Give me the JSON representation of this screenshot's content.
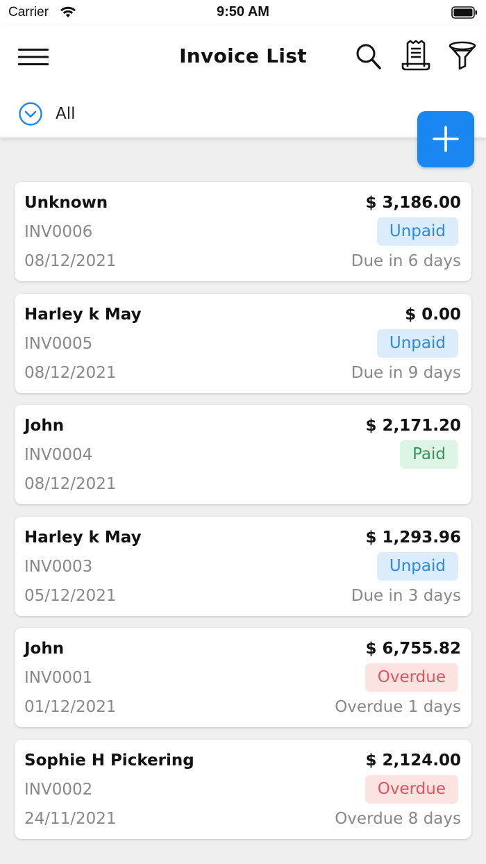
{
  "status_bar": {
    "carrier": "Carrier",
    "time": "9:50 AM",
    "icons": [
      "wifi-icon",
      "battery-icon"
    ]
  },
  "header": {
    "title": "Invoice List",
    "icons": [
      "menu-icon",
      "search-icon",
      "receipt-icon",
      "filter-icon"
    ],
    "filter": {
      "selected": "All",
      "icon": "chevron-circle-icon"
    }
  },
  "fab": {
    "icon": "plus-icon"
  },
  "colors": {
    "accent": "#1a87f0",
    "unpaid_bg": "#dbecfd",
    "unpaid_text": "#2b8ae6",
    "paid_bg": "#ddf5e4",
    "paid_text": "#3d8f5a",
    "overdue_bg": "#fde2e2",
    "overdue_text": "#e2545a",
    "background": "#efefef"
  },
  "invoices": [
    {
      "name": "Unknown",
      "amount": "$ 3,186.00",
      "number": "INV0006",
      "date": "08/12/2021",
      "status": "Unpaid",
      "due": "Due in 6 days"
    },
    {
      "name": "Harley k May",
      "amount": "$ 0.00",
      "number": "INV0005",
      "date": "08/12/2021",
      "status": "Unpaid",
      "due": "Due in 9 days"
    },
    {
      "name": "John",
      "amount": "$ 2,171.20",
      "number": "INV0004",
      "date": "08/12/2021",
      "status": "Paid",
      "due": ""
    },
    {
      "name": "Harley k May",
      "amount": "$ 1,293.96",
      "number": "INV0003",
      "date": "05/12/2021",
      "status": "Unpaid",
      "due": "Due in 3 days"
    },
    {
      "name": "John",
      "amount": "$ 6,755.82",
      "number": "INV0001",
      "date": "01/12/2021",
      "status": "Overdue",
      "due": "Overdue 1 days"
    },
    {
      "name": "Sophie H Pickering",
      "amount": "$ 2,124.00",
      "number": "INV0002",
      "date": "24/11/2021",
      "status": "Overdue",
      "due": "Overdue 8 days"
    }
  ]
}
